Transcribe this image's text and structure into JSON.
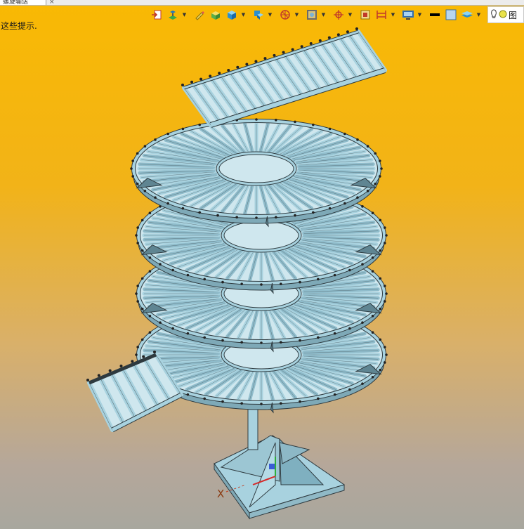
{
  "window": {
    "tab_title": "螺旋输送"
  },
  "viewport": {
    "hint_text": "这些提示.",
    "axis_x_label": "X",
    "background_top": "#f9b903",
    "background_bottom": "#a8a79e",
    "model_color": "#a8d2df"
  },
  "toolbar": {
    "icons": [
      "export-icon",
      "layer-tool-icon",
      "pencil-icon",
      "box-icon",
      "cube-icon",
      "view-icon",
      "section-wheel-icon",
      "frame-icon",
      "crosshair-icon",
      "select-icon",
      "dimension-icon",
      "display-icon",
      "line-color-icon",
      "face-color-icon",
      "layer-icon",
      "lightbulb-icon"
    ],
    "render_label": "图"
  }
}
